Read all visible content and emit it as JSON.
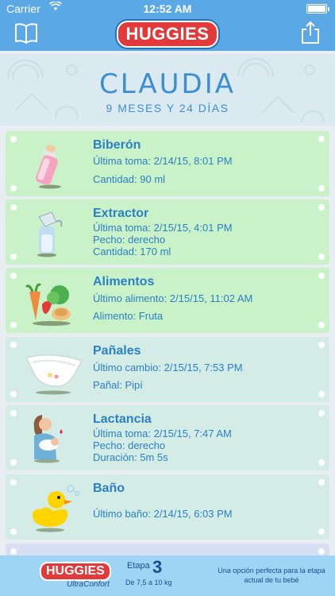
{
  "status_bar": {
    "carrier": "Carrier",
    "time": "12:52 AM"
  },
  "nav": {
    "logo": "HUGGIES"
  },
  "header": {
    "name": "CLAUDIA",
    "age": "9 MESES Y 24 DÍAS"
  },
  "cards": [
    {
      "title": "Biberón",
      "line1": "Última toma: 2/14/15, 8:01 PM",
      "line2": "Cantidad: 90 ml",
      "icon": "baby-bottle-icon"
    },
    {
      "title": "Extractor",
      "line1": "Última toma: 2/15/15, 4:01 PM",
      "line2": "Pecho: derecho",
      "line3": "Cantidad: 170 ml",
      "icon": "breast-pump-icon"
    },
    {
      "title": "Alimentos",
      "line1": "Último alimento: 2/15/15, 11:02 AM",
      "line2": "Alimento: Fruta",
      "icon": "food-icon"
    },
    {
      "title": "Pañales",
      "line1": "Último cambio: 2/15/15, 7:53 PM",
      "line2": "Pañal: Pipí",
      "icon": "diaper-icon"
    },
    {
      "title": "Lactancia",
      "line1": "Última toma: 2/15/15, 7:47 AM",
      "line2": "Pecho: derecho",
      "line3": "Duración: 5m 5s",
      "icon": "breastfeeding-icon"
    },
    {
      "title": "Baño",
      "line1": "Último baño: 2/14/15, 6:03 PM",
      "icon": "rubber-duck-icon"
    }
  ],
  "banner": {
    "logo": "HUGGIES",
    "sub": "UltraConfort",
    "etapa_label": "Etapa",
    "etapa_num": "3",
    "etapa_range": "De 7,5 a 10 kg",
    "tagline": "Una opción perfecta para la etapa actual de tu bebé"
  },
  "colors": {
    "nav": "#5aa8e6",
    "green_card": "#c9f2c8",
    "teal_card": "#d3ece6",
    "text_blue": "#2b7fc4",
    "logo_red": "#e23a3a"
  }
}
